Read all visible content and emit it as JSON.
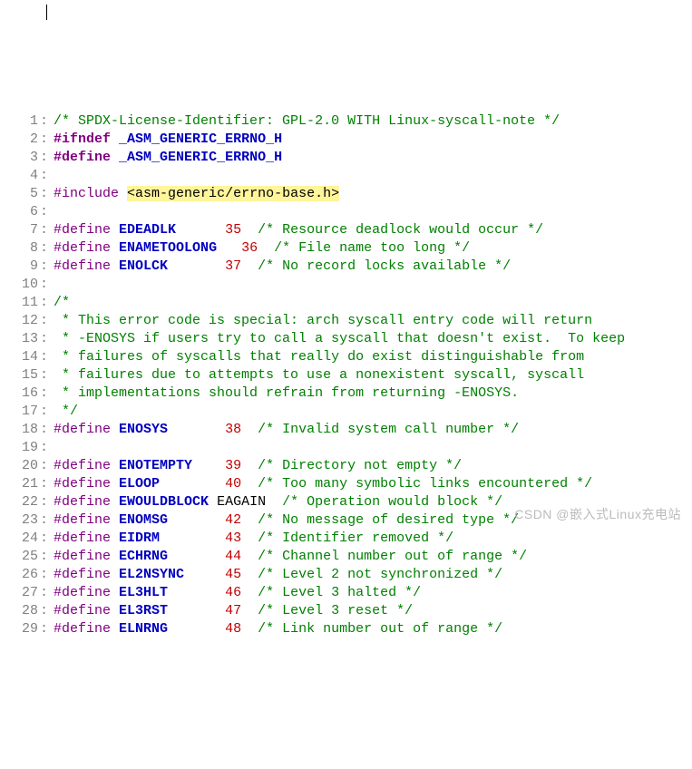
{
  "watermark": "CSDN @嵌入式Linux充电站",
  "lines": [
    {
      "n": 1,
      "html": "<span class='c-comment'>/* SPDX-License-Identifier: GPL-2.0 WITH Linux-syscall-note */</span>"
    },
    {
      "n": 2,
      "html": "<span class='c-pp c-bold'>#ifndef</span> <span class='c-macro'>_ASM_GENERIC_ERRNO_H</span>"
    },
    {
      "n": 3,
      "html": "<span class='c-pp c-bold'>#define</span> <span class='c-macro'>_ASM_GENERIC_ERRNO_H</span>"
    },
    {
      "n": 4,
      "html": ""
    },
    {
      "n": 5,
      "html": "<span class='c-pp'>#include</span> <span class='c-inc-hl'>&lt;asm-generic/errno-base.h&gt;</span>"
    },
    {
      "n": 6,
      "html": ""
    },
    {
      "n": 7,
      "html": "<span class='c-pp'>#define</span> <span class='c-macro'>EDEADLK</span>      <span class='c-num'>35</span>  <span class='c-comment'>/* Resource deadlock would occur */</span>"
    },
    {
      "n": 8,
      "html": "<span class='c-pp'>#define</span> <span class='c-macro'>ENAMETOOLONG</span>   <span class='c-num'>36</span>  <span class='c-comment'>/* File name too long */</span>"
    },
    {
      "n": 9,
      "html": "<span class='c-pp'>#define</span> <span class='c-macro'>ENOLCK</span>       <span class='c-num'>37</span>  <span class='c-comment'>/* No record locks available */</span>"
    },
    {
      "n": 10,
      "html": ""
    },
    {
      "n": 11,
      "html": "<span class='c-comment'>/*</span>"
    },
    {
      "n": 12,
      "html": "<span class='c-comment'> * This error code is special: arch syscall entry code will return</span>"
    },
    {
      "n": 13,
      "html": "<span class='c-comment'> * -ENOSYS if users try to call a syscall that doesn't exist.  To keep</span>"
    },
    {
      "n": 14,
      "html": "<span class='c-comment'> * failures of syscalls that really do exist distinguishable from</span>"
    },
    {
      "n": 15,
      "html": "<span class='c-comment'> * failures due to attempts to use a nonexistent syscall, syscall</span>"
    },
    {
      "n": 16,
      "html": "<span class='c-comment'> * implementations should refrain from returning -ENOSYS.</span>"
    },
    {
      "n": 17,
      "html": "<span class='c-comment'> */</span>"
    },
    {
      "n": 18,
      "html": "<span class='c-pp'>#define</span> <span class='c-macro'>ENOSYS</span>       <span class='c-num'>38</span>  <span class='c-comment'>/* Invalid system call number */</span>"
    },
    {
      "n": 19,
      "html": ""
    },
    {
      "n": 20,
      "html": "<span class='c-pp'>#define</span> <span class='c-macro'>ENOTEMPTY</span>    <span class='c-num'>39</span>  <span class='c-comment'>/* Directory not empty */</span>"
    },
    {
      "n": 21,
      "html": "<span class='c-pp'>#define</span> <span class='c-macro'>ELOOP</span>        <span class='c-num'>40</span>  <span class='c-comment'>/* Too many symbolic links encountered */</span>"
    },
    {
      "n": 22,
      "html": "<span class='c-pp'>#define</span> <span class='c-macro'>EWOULDBLOCK</span> <span class='c-ident'>EAGAIN</span>  <span class='c-comment'>/* Operation would block */</span>"
    },
    {
      "n": 23,
      "html": "<span class='c-pp'>#define</span> <span class='c-macro'>ENOMSG</span>       <span class='c-num'>42</span>  <span class='c-comment'>/* No message of desired type */</span>"
    },
    {
      "n": 24,
      "html": "<span class='c-pp'>#define</span> <span class='c-macro'>EIDRM</span>        <span class='c-num'>43</span>  <span class='c-comment'>/* Identifier removed */</span>"
    },
    {
      "n": 25,
      "html": "<span class='c-pp'>#define</span> <span class='c-macro'>ECHRNG</span>       <span class='c-num'>44</span>  <span class='c-comment'>/* Channel number out of range */</span>"
    },
    {
      "n": 26,
      "html": "<span class='c-pp'>#define</span> <span class='c-macro'>EL2NSYNC</span>     <span class='c-num'>45</span>  <span class='c-comment'>/* Level 2 not synchronized */</span>"
    },
    {
      "n": 27,
      "html": "<span class='c-pp'>#define</span> <span class='c-macro'>EL3HLT</span>       <span class='c-num'>46</span>  <span class='c-comment'>/* Level 3 halted */</span>"
    },
    {
      "n": 28,
      "html": "<span class='c-pp'>#define</span> <span class='c-macro'>EL3RST</span>       <span class='c-num'>47</span>  <span class='c-comment'>/* Level 3 reset */</span>"
    },
    {
      "n": 29,
      "html": "<span class='c-pp'>#define</span> <span class='c-macro'>ELNRNG</span>       <span class='c-num'>48</span>  <span class='c-comment'>/* Link number out of range */</span>"
    }
  ]
}
